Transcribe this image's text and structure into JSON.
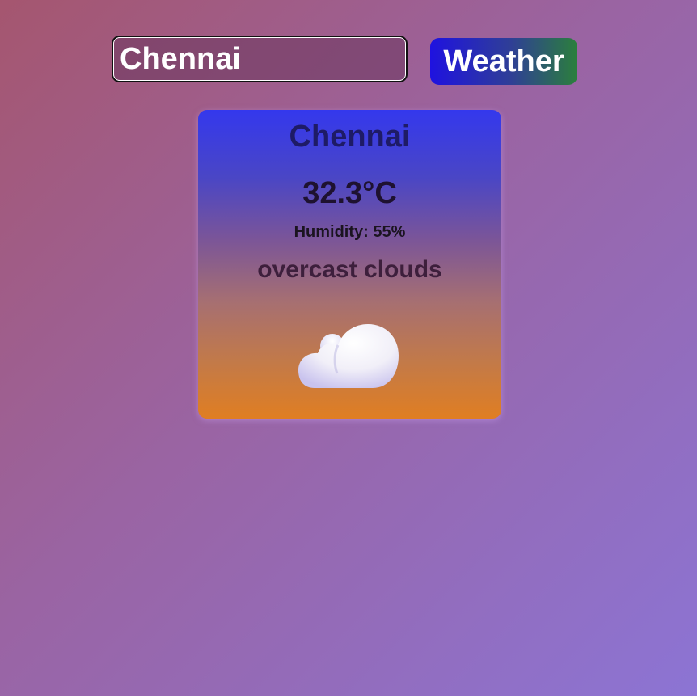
{
  "search": {
    "city_value": "Chennai",
    "button_label": "Weather"
  },
  "weather": {
    "city": "Chennai",
    "temperature": "32.3°C",
    "humidity": "Humidity: 55%",
    "description": "overcast clouds",
    "icon": "cloud-icon"
  },
  "colors": {
    "button_gradient_start": "#1f12e0",
    "button_gradient_end": "#2b7f3c",
    "card_gradient_top": "#3438ed",
    "card_gradient_bottom": "#e07e22"
  }
}
